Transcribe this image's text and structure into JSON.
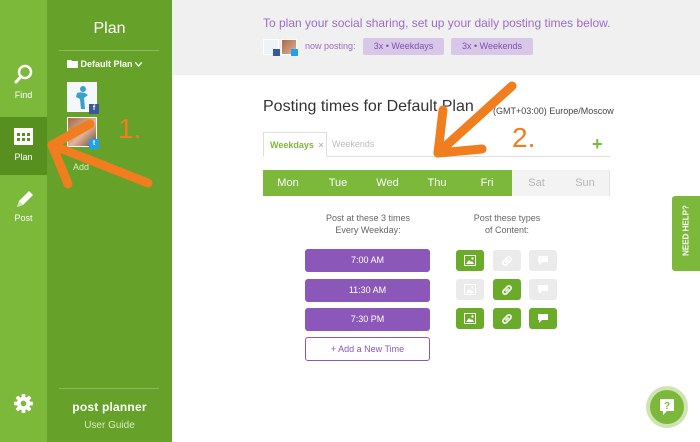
{
  "nav": {
    "items": [
      {
        "label": "Find",
        "icon": "search-icon"
      },
      {
        "label": "Plan",
        "icon": "calendar-icon",
        "active": true
      },
      {
        "label": "Post",
        "icon": "pencil-icon"
      }
    ],
    "settings_icon": "gear-icon"
  },
  "panel": {
    "title": "Plan",
    "plan_select": "Default Plan",
    "add_account": "Add",
    "logo": "post planner",
    "user_guide": "User Guide"
  },
  "banner": {
    "message": "To plan your social sharing, set up your daily posting times below.",
    "now_posting": "now posting:",
    "chips": [
      "3x • Weekdays",
      "3x • Weekends"
    ]
  },
  "main": {
    "heading": "Posting times for Default Plan",
    "timezone": "(GMT+03:00) Europe/Moscow",
    "tabs": [
      {
        "label": "Weekdays",
        "active": true
      },
      {
        "label": "Weekends",
        "active": false
      }
    ],
    "days": [
      {
        "label": "Mon",
        "on": true
      },
      {
        "label": "Tue",
        "on": true
      },
      {
        "label": "Wed",
        "on": true
      },
      {
        "label": "Thu",
        "on": true
      },
      {
        "label": "Fri",
        "on": true
      },
      {
        "label": "Sat",
        "on": false
      },
      {
        "label": "Sun",
        "on": false
      }
    ],
    "times_header_1": "Post at these 3 times",
    "times_header_2": "Every Weekday:",
    "types_header_1": "Post these types",
    "types_header_2": "of Content:",
    "times": [
      "7:00 AM",
      "11:30 AM",
      "7:30 PM"
    ],
    "content_types": [
      {
        "image": true,
        "link": false,
        "text": false
      },
      {
        "image": false,
        "link": true,
        "text": false
      },
      {
        "image": true,
        "link": true,
        "text": true
      }
    ],
    "add_time": "+ Add a New Time"
  },
  "need_help": "NEED HELP?",
  "annotations": {
    "step1": "1.",
    "step2": "2."
  },
  "colors": {
    "rail": "#7cb83a",
    "panel": "#66a12a",
    "accent_purple": "#8b57b8",
    "annotation_orange": "#f07d1e"
  }
}
